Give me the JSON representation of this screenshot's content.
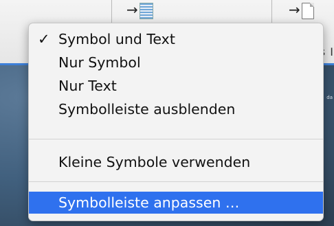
{
  "toolbar": {
    "icons": [
      {
        "icon": "arrow-right-image-icon"
      },
      {
        "icon": "arrow-right-document-icon"
      }
    ],
    "glyphs": {
      "arrow": "→"
    },
    "partial_label": "s I"
  },
  "content": {
    "side_caption": "da"
  },
  "menu": {
    "check_glyph": "✓",
    "items": [
      {
        "label": "Symbol und Text",
        "checked": true
      },
      {
        "label": "Nur Symbol",
        "checked": false
      },
      {
        "label": "Nur Text",
        "checked": false
      },
      {
        "label": "Symbolleiste ausblenden",
        "checked": false
      },
      {
        "label": "Kleine Symbole verwenden",
        "checked": false
      },
      {
        "label": "Symbolleiste anpassen …",
        "checked": false,
        "highlighted": true
      }
    ]
  },
  "colors": {
    "highlight": "#2f71ee",
    "menu_background": "#f3f3f3",
    "accent_strip": "#3d7fd8"
  }
}
